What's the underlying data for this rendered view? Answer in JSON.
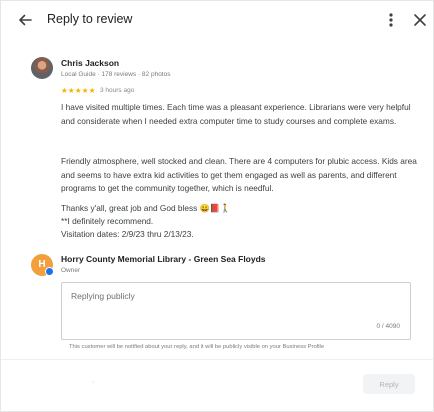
{
  "header": {
    "title": "Reply to review",
    "back_icon": "arrow-left-icon",
    "more_icon": "more-vert-icon",
    "close_icon": "close-icon"
  },
  "review": {
    "reviewer_name": "Chris Jackson",
    "reviewer_meta": "Local Guide · 178 reviews · 82 photos",
    "rating": 5,
    "stars_text": "★★★★★",
    "age": "3 hours ago",
    "paragraphs": {
      "p1": "I have visited multiple times. Each time was a pleasant experience. Librarians were very helpful and considerate when I needed extra computer time to study courses and complete exams.",
      "p2": "Friendly atmosphere, well stocked and clean. There are 4 computers for plubic access. Kids area and seems to have extra kid activities to get them engaged as well as parents, and different programs to get the community together, which is needful.",
      "p3": "Thanks y'all, great job and God bless 😀📕🚶",
      "p4": "**I definitely recommend.",
      "p5": "Visitation dates: 2/9/23 thru 2/13/23."
    }
  },
  "owner": {
    "initial": "H",
    "name": "Horry County Memorial Library - Green Sea Floyds",
    "role": "Owner",
    "color": "#f29f3d"
  },
  "reply": {
    "placeholder": "Replying publicly",
    "value": "",
    "counter": "0 / 4090",
    "notice": "This customer will be notified about your reply, and it will be publicly visible on your Business Profile"
  },
  "footer": {
    "dot": "·",
    "reply_button": "Reply"
  },
  "colors": {
    "star": "#f4b400",
    "badge": "#1a73e8"
  }
}
